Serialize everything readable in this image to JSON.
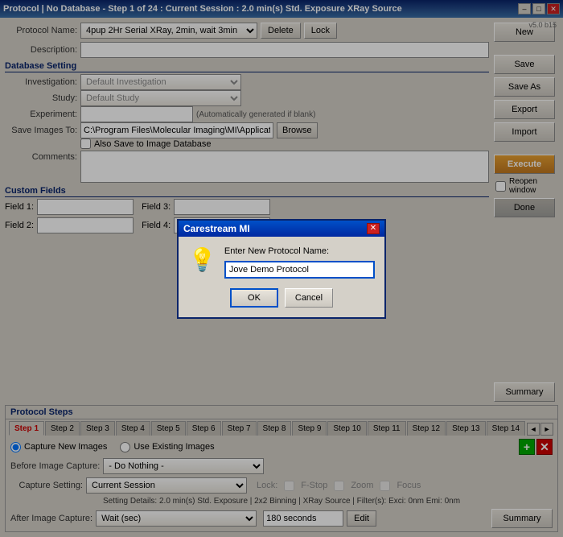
{
  "titleBar": {
    "title": "Protocol | No Database - Step 1 of 24 : Current Session : 2.0 min(s) Std. Exposure  XRay Source",
    "version": "v5.0 b15",
    "minBtn": "–",
    "maxBtn": "□",
    "closeBtn": "✕"
  },
  "header": {
    "protocolName_label": "Protocol Name:",
    "protocolName_value": "4pup 2Hr Serial XRay, 2min, wait 3min",
    "deleteBtn": "Delete",
    "lockBtn": "Lock",
    "description_label": "Description:"
  },
  "databaseSection": {
    "title": "Database Setting",
    "investigation_label": "Investigation:",
    "investigation_value": "Default Investigation",
    "study_label": "Study:",
    "study_value": "Default Study",
    "experiment_label": "Experiment:",
    "experiment_placeholder": "",
    "experiment_hint": "(Automatically generated if blank)",
    "saveImagesTo_label": "Save Images To:",
    "saveImagesTo_value": "C:\\Program Files\\Molecular Imaging\\MI\\Application\\Captured Im...",
    "browseBtn": "Browse",
    "alsoSave_label": "Also Save to Image Database",
    "comments_label": "Comments:"
  },
  "customFields": {
    "title": "Custom Fields",
    "field1_label": "Field 1:",
    "field2_label": "Field 2:",
    "field3_label": "Field 3:",
    "field4_label": "Field 4:"
  },
  "rightPanel": {
    "newBtn": "New",
    "saveBtn": "Save",
    "saveAsBtn": "Save As",
    "exportBtn": "Export",
    "importBtn": "Import",
    "executeBtn": "Execute",
    "reopenLabel": "Reopen window",
    "doneBtn": "Done",
    "summaryBtn": "Summary"
  },
  "protocolSteps": {
    "title": "Protocol Steps",
    "tabs": [
      "Step 1",
      "Step 2",
      "Step 3",
      "Step 4",
      "Step 5",
      "Step 6",
      "Step 7",
      "Step 8",
      "Step 9",
      "Step 10",
      "Step 11",
      "Step 12",
      "Step 13",
      "Step 14"
    ],
    "activeTab": 0,
    "captureNewImages": "Capture New Images",
    "useExistingImages": "Use Existing Images",
    "beforeCapture_label": "Before Image Capture:",
    "beforeCapture_value": "- Do Nothing -",
    "captureSetting_label": "Capture Setting:",
    "captureSetting_value": "Current Session",
    "lock_label": "Lock:",
    "fstop_label": "F-Stop",
    "zoom_label": "Zoom",
    "focus_label": "Focus",
    "settingDetails": "Setting Details: 2.0 min(s) Std. Exposure | 2x2 Binning | XRay Source | Filter(s): Exci: 0nm  Emi: 0nm",
    "afterCapture_label": "After Image Capture:",
    "afterCapture_value": "Wait (sec)",
    "afterCapture_seconds": "180 seconds",
    "editBtn": "Edit",
    "summaryBtn": "Summary"
  },
  "dialog": {
    "title": "Carestream MI",
    "closeBtn": "✕",
    "prompt": "Enter New Protocol Name:",
    "inputValue": "Jove Demo Protocol",
    "okBtn": "OK",
    "cancelBtn": "Cancel"
  }
}
